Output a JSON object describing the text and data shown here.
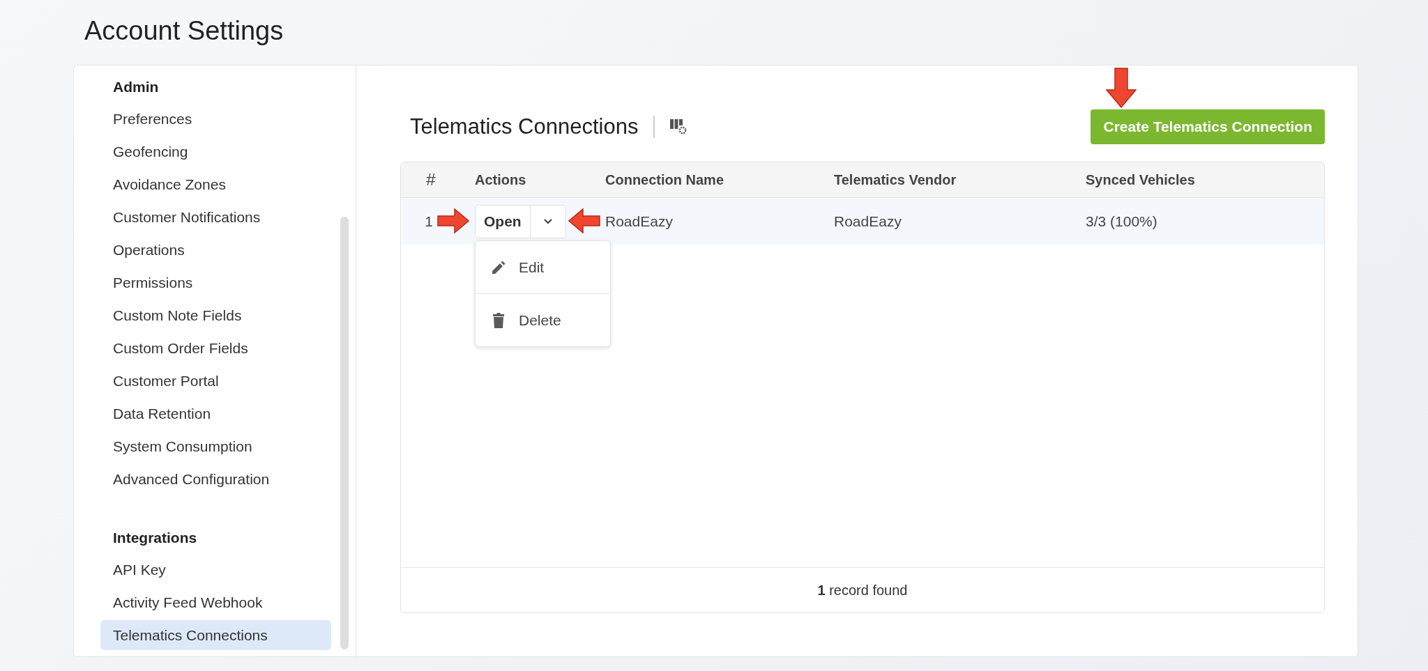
{
  "page": {
    "title": "Account Settings"
  },
  "sidebar": {
    "sections": [
      {
        "title": "Admin",
        "items": [
          {
            "label": "Preferences",
            "selected": false
          },
          {
            "label": "Geofencing",
            "selected": false
          },
          {
            "label": "Avoidance Zones",
            "selected": false
          },
          {
            "label": "Customer Notifications",
            "selected": false
          },
          {
            "label": "Operations",
            "selected": false
          },
          {
            "label": "Permissions",
            "selected": false
          },
          {
            "label": "Custom Note Fields",
            "selected": false
          },
          {
            "label": "Custom Order Fields",
            "selected": false
          },
          {
            "label": "Customer Portal",
            "selected": false
          },
          {
            "label": "Data Retention",
            "selected": false
          },
          {
            "label": "System Consumption",
            "selected": false
          },
          {
            "label": "Advanced Configuration",
            "selected": false
          }
        ]
      },
      {
        "title": "Integrations",
        "items": [
          {
            "label": "API Key",
            "selected": false
          },
          {
            "label": "Activity Feed Webhook",
            "selected": false
          },
          {
            "label": "Telematics Connections",
            "selected": true
          }
        ]
      }
    ]
  },
  "main": {
    "title": "Telematics Connections",
    "create_button": "Create Telematics Connection"
  },
  "table": {
    "columns": [
      "#",
      "Actions",
      "Connection Name",
      "Telematics Vendor",
      "Synced Vehicles"
    ],
    "rows": [
      {
        "number": "1",
        "open_button": "Open",
        "connection_name": "RoadEazy",
        "vendor": "RoadEazy",
        "synced": "3/3 (100%)"
      }
    ],
    "footer": "**1** record found"
  },
  "row_menu": {
    "items": [
      {
        "kind": "edit",
        "label": "Edit"
      },
      {
        "kind": "delete",
        "label": "Delete"
      }
    ]
  }
}
